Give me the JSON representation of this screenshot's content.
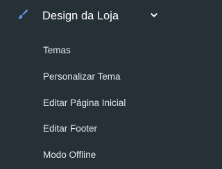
{
  "colors": {
    "background": "#263037",
    "title_text": "#ffffff",
    "item_text": "#e4e8eb",
    "accent_icon": "#5b9be8",
    "chevron": "#ffffff"
  },
  "menu": {
    "icon": "paint-brush-icon",
    "title": "Design da Loja",
    "expanded": true,
    "toggle_icon": "chevron-down-icon",
    "items": [
      {
        "label": "Temas"
      },
      {
        "label": "Personalizar Tema"
      },
      {
        "label": "Editar Página Inicial"
      },
      {
        "label": "Editar Footer"
      },
      {
        "label": "Modo Offline"
      }
    ]
  }
}
